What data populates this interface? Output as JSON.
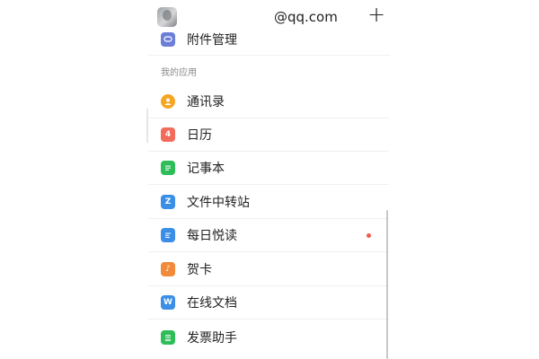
{
  "header": {
    "account": "@qq.com",
    "add_glyph": "+"
  },
  "attachments": {
    "label": "附件管理"
  },
  "section": {
    "title": "我的应用"
  },
  "apps": [
    {
      "label": "通讯录",
      "icon": "contacts-icon",
      "color": "#f5a623",
      "glyph": ""
    },
    {
      "label": "日历",
      "icon": "calendar-icon",
      "color": "#f26b5b",
      "glyph": "4"
    },
    {
      "label": "记事本",
      "icon": "notepad-icon",
      "color": "#2ebd59",
      "glyph": ""
    },
    {
      "label": "文件中转站",
      "icon": "file-transfer-icon",
      "color": "#3a8ee6",
      "glyph": "Z"
    },
    {
      "label": "每日悦读",
      "icon": "daily-reading-icon",
      "color": "#3a8ee6",
      "glyph": ""
    },
    {
      "label": "贺卡",
      "icon": "greeting-card-icon",
      "color": "#f28a3c",
      "glyph": "♪"
    },
    {
      "label": "在线文档",
      "icon": "online-docs-icon",
      "color": "#3a8ee6",
      "glyph": "W"
    },
    {
      "label": "发票助手",
      "icon": "invoice-assistant-icon",
      "color": "#2ebd59",
      "glyph": ""
    }
  ],
  "colors": {
    "attachment_icon": "#6b7fd7",
    "unread_dot": "#f05a50"
  },
  "handle_glyph": "〉"
}
